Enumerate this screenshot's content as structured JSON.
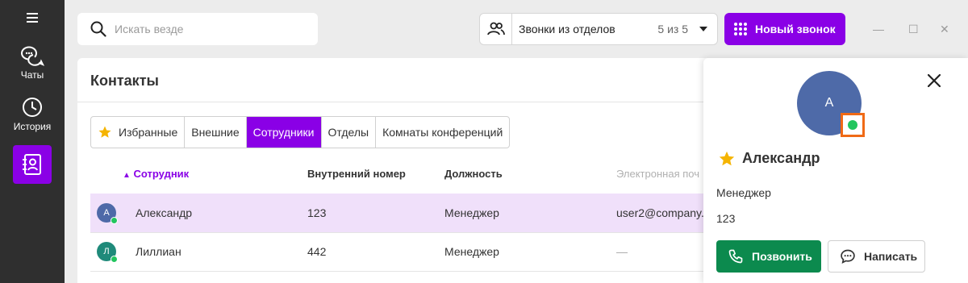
{
  "sidebar": {
    "items": [
      {
        "label": "Чаты",
        "icon": "chat-icon"
      },
      {
        "label": "История",
        "icon": "clock-icon"
      },
      {
        "label": "",
        "icon": "contacts-icon"
      }
    ]
  },
  "search": {
    "placeholder": "Искать везде",
    "value": ""
  },
  "department_filter": {
    "label": "Звонки из отделов",
    "count": "5 из 5",
    "icon": "people-icon"
  },
  "new_call": {
    "label": "Новый звонок",
    "icon": "dial-pad-icon"
  },
  "window_controls": {
    "minimize": "—",
    "maximize": "☐",
    "close": "✕"
  },
  "contacts": {
    "title": "Контакты",
    "tabs": [
      {
        "label": "Избранные",
        "active": false
      },
      {
        "label": "Внешние",
        "active": false
      },
      {
        "label": "Сотрудники",
        "active": true
      },
      {
        "label": "Отделы",
        "active": false
      },
      {
        "label": "Комнаты конференций",
        "active": false
      }
    ],
    "columns": {
      "employee": "Сотрудник",
      "sort_indicator": "▲",
      "extension": "Внутренний номер",
      "position": "Должность",
      "email": "Электронная поч"
    },
    "rows": [
      {
        "initial": "А",
        "name": "Александр",
        "extension": "123",
        "position": "Менеджер",
        "email": "user2@company.",
        "avatar_color": "#4e6aa8",
        "selected": true
      },
      {
        "initial": "Л",
        "name": "Лиллиан",
        "extension": "442",
        "position": "Менеджер",
        "email": "—",
        "avatar_color": "#1f8a7a",
        "selected": false
      }
    ]
  },
  "contact_card": {
    "initial": "А",
    "name": "Александр",
    "position": "Менеджер",
    "extension": "123",
    "call_label": "Позвонить",
    "message_label": "Написать",
    "status_color": "#22c55e"
  },
  "colors": {
    "accent": "#8a00e6",
    "call": "#0c8a4e",
    "highlight": "#f06a16"
  }
}
